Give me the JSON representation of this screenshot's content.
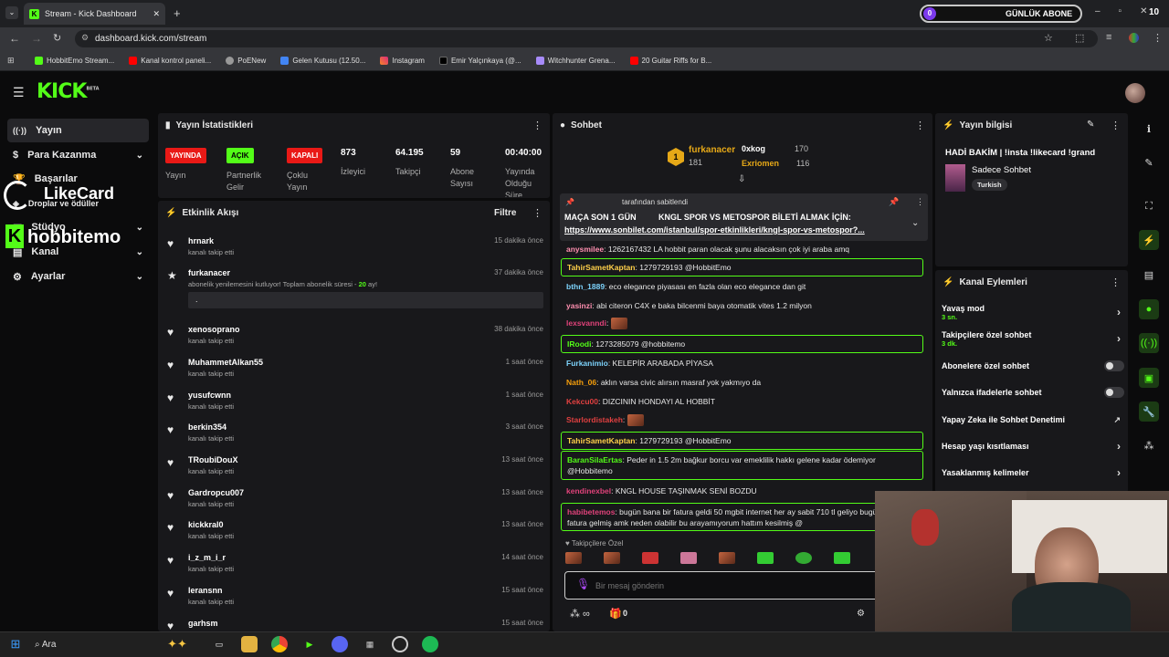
{
  "browser": {
    "tab_title": "Stream - Kick Dashboard",
    "url": "dashboard.kick.com/stream",
    "bookmarks": [
      "HobbitEmo Stream...",
      "Kanal kontrol paneli...",
      "PoENew",
      "Gelen Kutusu (12.50...",
      "Instagram",
      "Emir Yalçınkaya (@...",
      "Witchhunter Grena...",
      "20 Guitar Riffs for B..."
    ],
    "abone_widget": {
      "count": "0",
      "label": "GÜNLÜK ABONE",
      "right": "10"
    }
  },
  "header": {
    "logo": "KICK",
    "logo_sup": "BETA"
  },
  "sidebar": {
    "items": [
      {
        "label": "Yayın"
      },
      {
        "label": "Para Kazanma"
      },
      {
        "label": "Başarılar"
      },
      {
        "label": "Droplar ve ödüller"
      },
      {
        "label": "Stüdyo"
      },
      {
        "label": "Kanal"
      },
      {
        "label": "Ayarlar"
      }
    ],
    "overlay": {
      "likecard": "LikeCard",
      "hobbitemo": "hobbitemo"
    }
  },
  "stats": {
    "title": "Yayın İstatistikleri",
    "yayinda": "YAYINDA",
    "yayin": "Yayın",
    "acik": "AÇIK",
    "partnerlik": "Partnerlik Gelir",
    "kapali": "KAPALI",
    "coklu": "Çoklu Yayın",
    "izleyici_val": "873",
    "izleyici": "İzleyici",
    "takipci_val": "64.195",
    "takipci": "Takipçi",
    "abone_val": "59",
    "abone": "Abone Sayısı",
    "sure_val": "00:40:00",
    "sure": "Yayında Olduğu Süre"
  },
  "activity": {
    "title": "Etkinlik Akışı",
    "filter": "Filtre",
    "sub": {
      "user": "furkanacer",
      "text_a": "abonelik yenilemesini kutluyor! Toplam abonelik süresi - ",
      "months": "20",
      "text_b": " ay!",
      "reply": ".",
      "time": "37 dakika önce"
    },
    "follows": [
      {
        "user": "hrnark",
        "sub": "kanalı takip etti",
        "time": "15 dakika önce"
      },
      {
        "user": "xenosoprano",
        "sub": "kanalı takip etti",
        "time": "38 dakika önce"
      },
      {
        "user": "MuhammetAlkan55",
        "sub": "kanalı takip etti",
        "time": "1 saat önce"
      },
      {
        "user": "yusufcwnn",
        "sub": "kanalı takip etti",
        "time": "1 saat önce"
      },
      {
        "user": "berkin354",
        "sub": "kanalı takip etti",
        "time": "3 saat önce"
      },
      {
        "user": "TRoubiDouX",
        "sub": "kanalı takip etti",
        "time": "13 saat önce"
      },
      {
        "user": "Gardropcu007",
        "sub": "kanalı takip etti",
        "time": "13 saat önce"
      },
      {
        "user": "kickkral0",
        "sub": "kanalı takip etti",
        "time": "13 saat önce"
      },
      {
        "user": "i_z_m_i_r",
        "sub": "kanalı takip etti",
        "time": "14 saat önce"
      },
      {
        "user": "leransnn",
        "sub": "kanalı takip etti",
        "time": "15 saat önce"
      },
      {
        "user": "garhsm",
        "sub": "",
        "time": "15 saat önce"
      }
    ]
  },
  "chat": {
    "title": "Sohbet",
    "leaders": [
      {
        "rank": "1",
        "name": "furkanacer",
        "val": "181"
      },
      {
        "name": "0xkog",
        "val": "170"
      },
      {
        "name": "Exriomen",
        "val": "116"
      }
    ],
    "pinned": {
      "by": "tarafından sabitlendi",
      "text": "MAÇA SON 1 GÜN",
      "text2": "KNGL SPOR VS METOSPOR BİLETİ ALMAK İÇİN:",
      "link": "https://www.sonbilet.com/istanbul/spor-etkinlikleri/kngl-spor-vs-metospor?..."
    },
    "messages": [
      {
        "user": "anysmilee",
        "color": "#ff8fb0",
        "text": "1262167432 LA hobbit paran olacak şunu alacaksın çok iyi araba amq",
        "hl": false
      },
      {
        "user": "TahirSametKaptan",
        "color": "#ffd04a",
        "text": "1279729193 @HobbitEmo",
        "hl": true
      },
      {
        "user": "bthn_1889",
        "color": "#7dd3fc",
        "text": "eco elegance piyasası en fazla olan eco elegance dan git",
        "hl": false
      },
      {
        "user": "yasinzi",
        "color": "#ff8fb0",
        "text": "abi citeron C4X e baka bilcenmi baya otomatik vites 1.2 milyon",
        "hl": false
      },
      {
        "user": "lexsvanndi",
        "color": "#e0427a",
        "text": "",
        "hl": false,
        "emote": true
      },
      {
        "user": "IRoodi",
        "color": "#53fc18",
        "text": "1273285079 @hobbitemo",
        "hl": true
      },
      {
        "user": "Furkanimio",
        "color": "#7dd3fc",
        "text": "KELEPİR ARABADA PİYASA",
        "hl": false
      },
      {
        "user": "Nath_06",
        "color": "#f59e0b",
        "text": "aklın varsa civic alırsın masraf yok yakmıyo da",
        "hl": false
      },
      {
        "user": "Kekcu00",
        "color": "#e04040",
        "text": "DIZCININ HONDAYI AL HOBBİT",
        "hl": false
      },
      {
        "user": "Starlordistakeh",
        "color": "#e04040",
        "text": "",
        "hl": false,
        "emote": true
      },
      {
        "user": "TahirSametKaptan",
        "color": "#ffd04a",
        "text": "1279729193 @HobbitEmo",
        "hl": true
      },
      {
        "user": "BaranSilaErtas",
        "color": "#53fc18",
        "text": "Peder in 1.5 2m bağkur borcu var emeklilik hakkı gelene kadar ödemiyor @Hobbitemo",
        "hl": true
      },
      {
        "user": "kendinexbel",
        "color": "#e0427a",
        "text": "KNGL HOUSE TAŞINMAK SENİ BOZDU",
        "hl": false
      },
      {
        "user": "habibetemos",
        "color": "#e0427a",
        "text": "bugün bana bir fatura geldi 50 mgbit internet her ay sabit 710 tl geliyo bugün 5573 tl fatura gelmiş amk neden olabilir bu arayamıyorum hattım kesilmiş @",
        "hl": true
      }
    ],
    "followers_only": "Takipçilere Özel",
    "input_placeholder": "Bir mesaj gönderin",
    "gift_count": "0"
  },
  "info": {
    "title": "Yayın bilgisi",
    "stream_title": "HADİ BAKİM | !insta !likecard !grand",
    "category": "Sadece Sohbet",
    "tag": "Turkish"
  },
  "actions": {
    "title": "Kanal Eylemleri",
    "slow": "Yavaş mod",
    "slow_val": "3 sn.",
    "followers": "Takipçilere özel sohbet",
    "followers_val": "3 dk.",
    "subs": "Abonelere özel sohbet",
    "emotes": "Yalnızca ifadelerle sohbet",
    "ai": "Yapay Zeka ile Sohbet Denetimi",
    "age": "Hesap yaşı kısıtlaması",
    "banned": "Yasaklanmış kelimeler"
  },
  "taskbar": {
    "search": "Ara"
  }
}
